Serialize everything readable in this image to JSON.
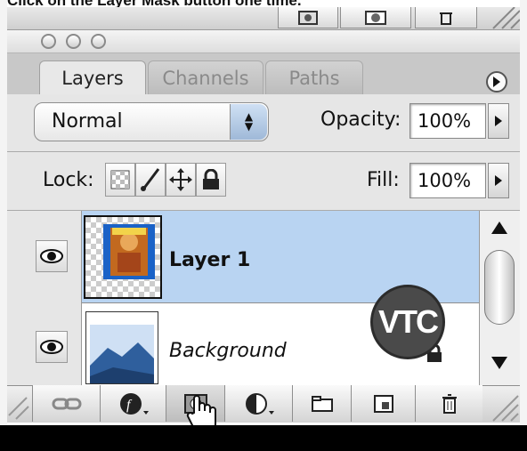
{
  "caption": "Click on the Layer Mask button one time.",
  "window": {
    "lights": [
      "close",
      "minimize",
      "zoom"
    ]
  },
  "tabs": [
    {
      "label": "Layers",
      "active": true
    },
    {
      "label": "Channels",
      "active": false
    },
    {
      "label": "Paths",
      "active": false
    }
  ],
  "blend": {
    "value": "Normal"
  },
  "opacity": {
    "label": "Opacity:",
    "value": "100%"
  },
  "lock": {
    "label": "Lock:"
  },
  "fill": {
    "label": "Fill:",
    "value": "100%"
  },
  "layers": [
    {
      "name": "Layer 1",
      "selected": true,
      "visible": true
    },
    {
      "name": "Background",
      "selected": false,
      "visible": true
    }
  ],
  "watermark": "VTC",
  "colors": {
    "selected_row": "#b9d4f2",
    "accent": "#1a62c7"
  },
  "icons": [
    "eye-icon",
    "lock-transparent-icon",
    "lock-brush-icon",
    "lock-move-icon",
    "lock-all-icon",
    "link-icon",
    "layer-style-icon",
    "layer-mask-icon",
    "adjustment-layer-icon",
    "folder-icon",
    "new-layer-icon",
    "trash-icon",
    "hand-cursor-icon",
    "panel-menu-icon"
  ]
}
